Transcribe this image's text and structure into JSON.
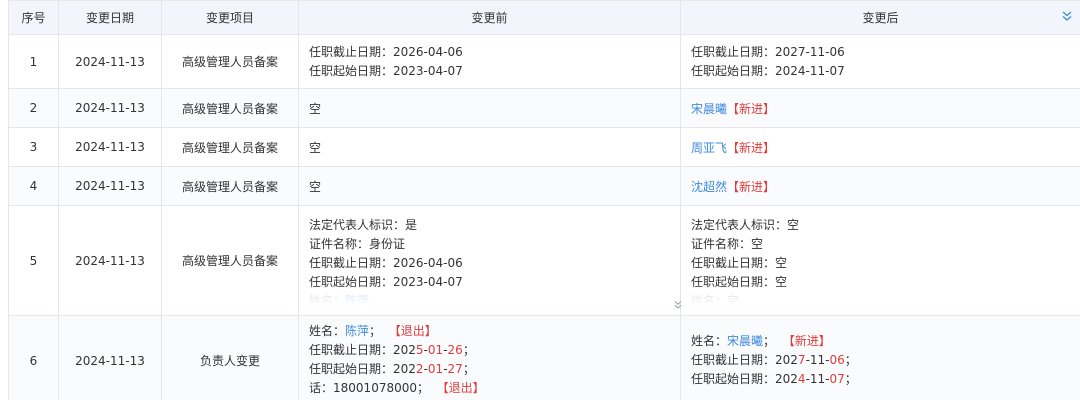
{
  "headers": {
    "seq": "序号",
    "date": "变更日期",
    "item": "变更项目",
    "before": "变更前",
    "after": "变更后"
  },
  "icons": {
    "collapse": "double-chevron-down-icon",
    "expand": "double-chevron-down-icon"
  },
  "colors": {
    "link": "#3f8ae0",
    "tag": "#e23b3b",
    "header_bg": "#f2f6fc",
    "border": "#e6e6e6"
  },
  "rows": [
    {
      "seq": "1",
      "date": "2024-11-13",
      "item": "高级管理人员备案",
      "before": [
        {
          "label": "任职截止日期：",
          "value": "2026-04-06"
        },
        {
          "label": "任职起始日期：",
          "value": "2023-04-07"
        }
      ],
      "after": [
        {
          "label": "任职截止日期：",
          "value": "2027-11-06"
        },
        {
          "label": "任职起始日期：",
          "value": "2024-11-07"
        }
      ]
    },
    {
      "seq": "2",
      "date": "2024-11-13",
      "item": "高级管理人员备案",
      "before_text": "空",
      "after_name": "宋晨曦",
      "after_tag": "【新进】"
    },
    {
      "seq": "3",
      "date": "2024-11-13",
      "item": "高级管理人员备案",
      "before_text": "空",
      "after_name": "周亚飞",
      "after_tag": "【新进】"
    },
    {
      "seq": "4",
      "date": "2024-11-13",
      "item": "高级管理人员备案",
      "before_text": "空",
      "after_name": "沈超然",
      "after_tag": "【新进】"
    },
    {
      "seq": "5",
      "date": "2024-11-13",
      "item": "高级管理人员备案",
      "before": [
        {
          "label": "法定代表人标识：",
          "value": "是"
        },
        {
          "label": "证件名称：",
          "value": "身份证"
        },
        {
          "label": "任职截止日期：",
          "value": "2026-04-06"
        },
        {
          "label": "任职起始日期：",
          "value": "2023-04-07"
        },
        {
          "label": "姓名：",
          "value": "陈萍"
        }
      ],
      "after": [
        {
          "label": "法定代表人标识：",
          "value": "空"
        },
        {
          "label": "证件名称：",
          "value": "空"
        },
        {
          "label": "任职截止日期：",
          "value": "空"
        },
        {
          "label": "任职起始日期：",
          "value": "空"
        },
        {
          "label": "姓名：",
          "value": "空"
        }
      ]
    },
    {
      "seq": "6",
      "date": "2024-11-13",
      "item": "负责人变更",
      "before": {
        "name_label": "姓名：",
        "name": "陈萍",
        "name_sep": "；",
        "name_tag": "【退出】",
        "end_label": "任职截止日期：",
        "end_a": "202",
        "end_b": "5",
        "end_c": "-",
        "end_d": "01",
        "end_e": "-",
        "end_f": "26",
        "end_g": "；",
        "start_label": "任职起始日期：",
        "start_a": "202",
        "start_b": "2",
        "start_c": "-",
        "start_d": "01",
        "start_e": "-",
        "start_f": "27",
        "start_g": "；",
        "phone_label": "话：",
        "phone": "18001078000；",
        "phone_tag": "【退出】"
      },
      "after": {
        "name_label": "姓名：",
        "name": "宋晨曦",
        "name_sep": "；",
        "name_tag": "【新进】",
        "end_label": "任职截止日期：",
        "end_a": "202",
        "end_b": "7",
        "end_c": "-11-",
        "end_d": "06",
        "end_e": "；",
        "start_label": "任职起始日期：",
        "start_a": "202",
        "start_b": "4",
        "start_c": "-11-",
        "start_d": "07",
        "start_e": "；"
      }
    }
  ]
}
